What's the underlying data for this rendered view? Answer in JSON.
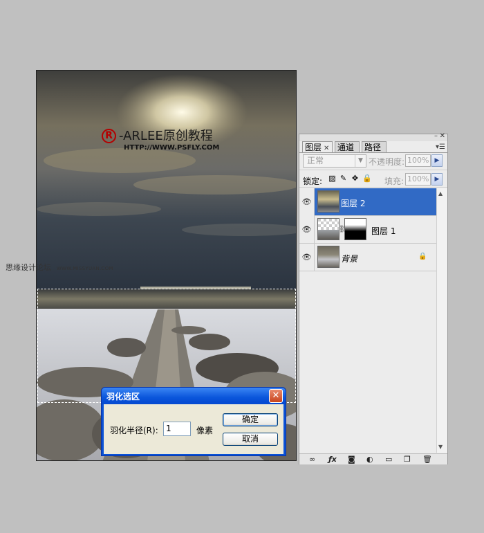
{
  "canvas": {
    "logo_symbol": "R",
    "logo_title": "-ARLEE原创教程",
    "logo_url": "HTTP://WWW.PSFLY.COM"
  },
  "watermark": {
    "chinese": "思缘设计论坛",
    "url": "WWW.MISSYUAN.COM"
  },
  "layers_panel": {
    "tabs": [
      {
        "label": "图层",
        "active": true
      },
      {
        "label": "通道",
        "active": false
      },
      {
        "label": "路径",
        "active": false
      }
    ],
    "blend_mode": "正常",
    "opacity_label": "不透明度:",
    "opacity_value": "100%",
    "lock_label": "锁定:",
    "fill_label": "填充:",
    "fill_value": "100%",
    "layers": [
      {
        "name": "图层 2",
        "selected": true
      },
      {
        "name": "图层 1",
        "selected": false
      },
      {
        "name": "背景",
        "selected": false,
        "locked": true
      }
    ],
    "footer_icons": [
      "link-icon",
      "fx-icon",
      "mask-icon",
      "adjustment-icon",
      "folder-icon",
      "new-layer-icon",
      "trash-icon"
    ]
  },
  "feather_dialog": {
    "title": "羽化选区",
    "radius_label": "羽化半径(R):",
    "radius_value": "1",
    "unit": "像素",
    "ok_label": "确定",
    "cancel_label": "取消"
  },
  "colors": {
    "selection_blue": "#316ac5",
    "dialog_title_blue": "#0a55db",
    "close_red": "#c8451e",
    "logo_red": "#b40000"
  }
}
